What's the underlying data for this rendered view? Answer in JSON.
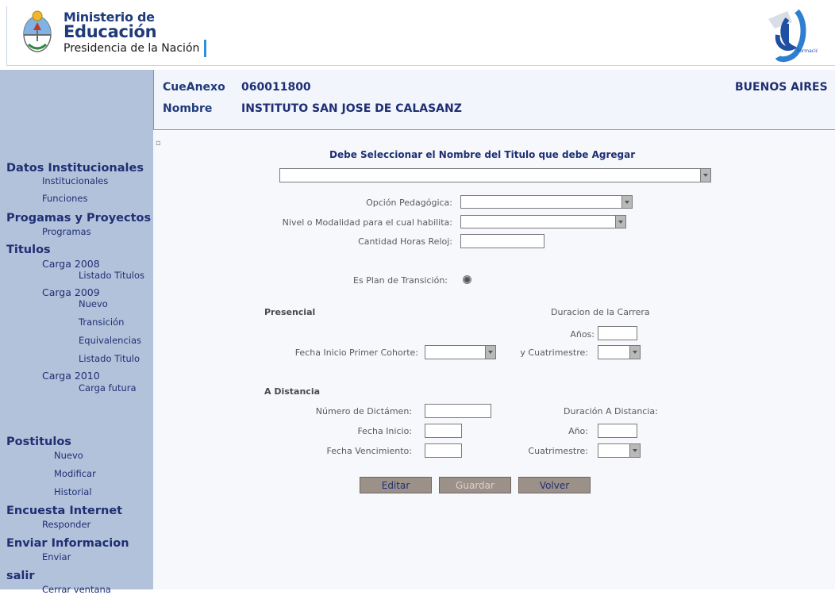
{
  "header": {
    "ministry_line1": "Ministerio de",
    "ministry_line2": "Educación",
    "ministry_line3": "Presidencia de la Nación"
  },
  "sidebar": {
    "sections": [
      {
        "title": "Datos Institucionales",
        "items": [
          "Institucionales",
          "Funciones"
        ]
      },
      {
        "title": "Progamas y Proyectos",
        "items": [
          "Programas"
        ]
      },
      {
        "title": "Titulos",
        "years": [
          {
            "year": "Carga 2008",
            "items": [
              "Listado Titulos"
            ]
          },
          {
            "year": "Carga 2009",
            "items": [
              "Nuevo",
              "Transición",
              "Equivalencias",
              "Listado Titulo"
            ]
          },
          {
            "year": "Carga 2010",
            "items": [
              "Carga futura"
            ]
          }
        ]
      },
      {
        "title": "Postitulos",
        "items": [
          "Nuevo",
          "Modificar",
          "Historial"
        ]
      },
      {
        "title": "Encuesta Internet",
        "items": [
          "Responder"
        ]
      },
      {
        "title": "Enviar Informacion",
        "items": [
          "Enviar"
        ]
      },
      {
        "title": "salir",
        "items": [
          "Cerrar ventana"
        ]
      }
    ]
  },
  "info": {
    "cue_label": "CueAnexo",
    "cue_value": "060011800",
    "nombre_label": "Nombre",
    "nombre_value": "INSTITUTO SAN JOSE DE CALASANZ",
    "province": "BUENOS AIRES"
  },
  "form": {
    "instruction": "Debe Seleccionar el Nombre del Titulo que debe Agregar",
    "titulo_value": "",
    "opcion_label": "Opción Pedagógica:",
    "nivel_label": "Nivel o Modalidad para el cual habilita:",
    "horas_label": "Cantidad Horas Reloj:",
    "plan_label": "Es Plan de Transición:",
    "presencial_title": "Presencial",
    "duracion_title": "Duracion de la Carrera",
    "anios_label": "Años:",
    "fecha_cohorte_label": "Fecha Inicio Primer Cohorte:",
    "cuatrimestre_label": "y Cuatrimestre:",
    "distancia_title": "A Distancia",
    "dictamen_label": "Número de Dictámen:",
    "duracion_distancia_label": "Duración A Distancia:",
    "fecha_inicio_label": "Fecha Inicio:",
    "anio_label": "Año:",
    "fecha_venc_label": "Fecha Vencimiento:",
    "cuatrimestre2_label": "Cuatrimestre:"
  },
  "buttons": {
    "editar": "Editar",
    "guardar": "Guardar",
    "volver": "Volver"
  },
  "colors": {
    "sidebar_bg": "#b2c2db",
    "brand_blue": "#1f2f73",
    "button_bg": "#9c9189"
  }
}
